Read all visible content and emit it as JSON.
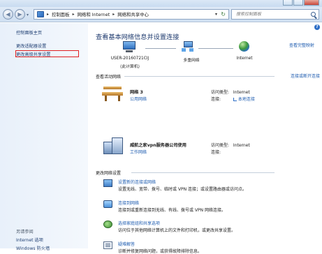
{
  "address_bar": {
    "breadcrumbs": [
      "控制面板",
      "网络和 Internet",
      "网络和共享中心"
    ],
    "search_placeholder": "搜索控制面板"
  },
  "left_pane": {
    "home": "控制面板主页",
    "adapter_settings": "更改适配器设置",
    "advanced_sharing": "更改高级共享设置",
    "see_also_title": "另请参阅",
    "see_also_internet": "Internet 选项",
    "see_also_firewall": "Windows 防火墙"
  },
  "main": {
    "heading": "查看基本网络信息并设置连接",
    "full_map_link": "查看完整映射",
    "map": {
      "pc_name": "USER-20160721CIJ",
      "pc_sub": "(此计算机)",
      "middle_label": "多重网络",
      "internet_label": "Internet"
    },
    "active_header": "查看活动网络",
    "connect_link": "连接或断开连接",
    "networks": [
      {
        "name": "网络 3",
        "type": "公用网络",
        "access_label": "访问类型:",
        "access_value": "Internet",
        "conn_label": "连接:",
        "conn_value": "本地连接"
      },
      {
        "name": "威航之家vpn服务器公司使用",
        "type": "工作网络",
        "access_label": "访问类型:",
        "access_value": "Internet",
        "conn_label": "连接:",
        "conn_value": ""
      }
    ],
    "change_header": "更改网络设置",
    "tasks": [
      {
        "link": "设置新的连接或网络",
        "desc": "设置无线、宽带、拨号、临时或 VPN 连接；或设置路由器或访问点。"
      },
      {
        "link": "连接到网络",
        "desc": "连接到或重新连接到无线、有线、拨号或 VPN 网络连接。"
      },
      {
        "link": "选择家庭组和共享选项",
        "desc": "访问位于其他网络计算机上的文件和打印机，或更改共享设置。"
      },
      {
        "link": "疑难解答",
        "desc": "诊断并修复网络问题，或获得故障排除信息。"
      }
    ]
  }
}
